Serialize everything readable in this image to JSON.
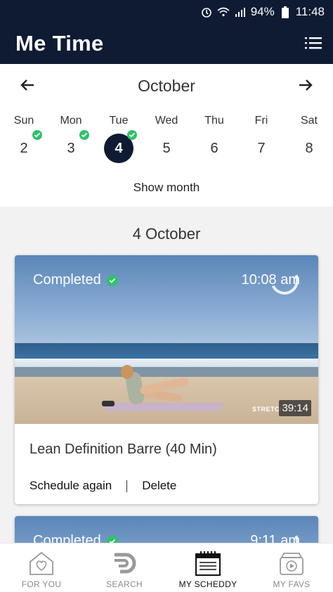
{
  "status_bar": {
    "battery": "94%",
    "time": "11:48"
  },
  "app": {
    "title": "Me Time"
  },
  "calendar": {
    "month": "October",
    "days": [
      {
        "name": "Sun",
        "num": "2",
        "done": true,
        "selected": false
      },
      {
        "name": "Mon",
        "num": "3",
        "done": true,
        "selected": false
      },
      {
        "name": "Tue",
        "num": "4",
        "done": true,
        "selected": true
      },
      {
        "name": "Wed",
        "num": "5",
        "done": false,
        "selected": false
      },
      {
        "name": "Thu",
        "num": "6",
        "done": false,
        "selected": false
      },
      {
        "name": "Fri",
        "num": "7",
        "done": false,
        "selected": false
      },
      {
        "name": "Sat",
        "num": "8",
        "done": false,
        "selected": false
      }
    ],
    "show_month_label": "Show month"
  },
  "list": {
    "date_header": "4 October",
    "cards": [
      {
        "status": "Completed",
        "time": "10:08 am",
        "duration": "39:14",
        "brand": "STRETCH",
        "title": "Lean Definition Barre (40 Min)",
        "action_primary": "Schedule again",
        "action_secondary": "Delete"
      },
      {
        "status": "Completed",
        "time": "9:11 am"
      }
    ]
  },
  "bottom_nav": {
    "tabs": [
      {
        "label": "FOR YOU",
        "icon": "heart-house-icon",
        "active": false
      },
      {
        "label": "SEARCH",
        "icon": "search-logo-icon",
        "active": false
      },
      {
        "label": "MY SCHEDDY",
        "icon": "calendar-icon",
        "active": true
      },
      {
        "label": "MY FAVS",
        "icon": "play-favorites-icon",
        "active": false
      }
    ]
  },
  "colors": {
    "header_bg": "#0f1b33",
    "check_green": "#2ec26a"
  }
}
